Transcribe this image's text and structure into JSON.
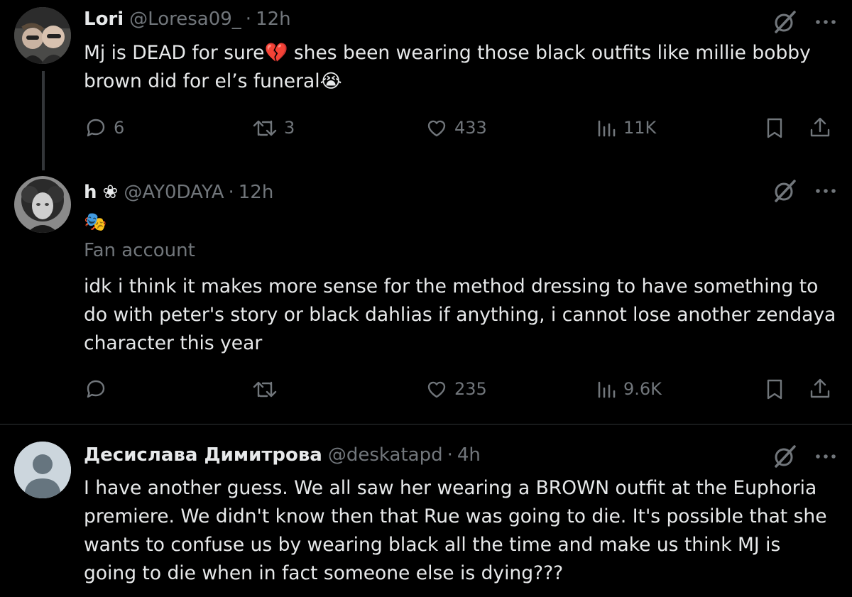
{
  "tweets": [
    {
      "name": "Lori",
      "handle": "@Loresa09_",
      "sep": "·",
      "time": "12h",
      "text_a": "Mj is DEAD for sure",
      "text_emoji_a": "💔",
      "text_b": " shes been wearing those black outfits like millie bobby brown did for el’s funeral",
      "text_emoji_b": "😭",
      "replies": "6",
      "reposts": "3",
      "likes": "433",
      "views": "11K"
    },
    {
      "name": "h",
      "name_emoji": "❀",
      "handle": "@AY0DAYA",
      "sep": "·",
      "time": "12h",
      "badge_emoji": "🎭",
      "subtitle": "Fan account",
      "text": "idk i think it makes more sense for the method dressing  to have something to do with peter's story or black dahlias if anything, i cannot lose another zendaya character this year",
      "replies": "",
      "reposts": "",
      "likes": "235",
      "views": "9.6K"
    },
    {
      "name": "Десислава Димитрова",
      "handle": "@deskatapd",
      "sep": "·",
      "time": "4h",
      "text": "I have another guess. We all saw her wearing a BROWN outfit at the Euphoria premiere. We didn't know then that Rue was going to die. It's possible that she wants to confuse us by wearing black all the time and make us think MJ is going to die when in fact someone else is dying???"
    }
  ],
  "icons": {
    "more": "more-dots-icon",
    "grok": "grok-slash-icon",
    "reply": "reply-bubble-icon",
    "repost": "repost-icon",
    "like": "heart-icon",
    "views": "views-bars-icon",
    "bookmark": "bookmark-icon",
    "share": "share-icon"
  },
  "colors": {
    "background": "#000000",
    "text": "#e7e9ea",
    "muted": "#71767b",
    "divider": "#2f3336"
  }
}
